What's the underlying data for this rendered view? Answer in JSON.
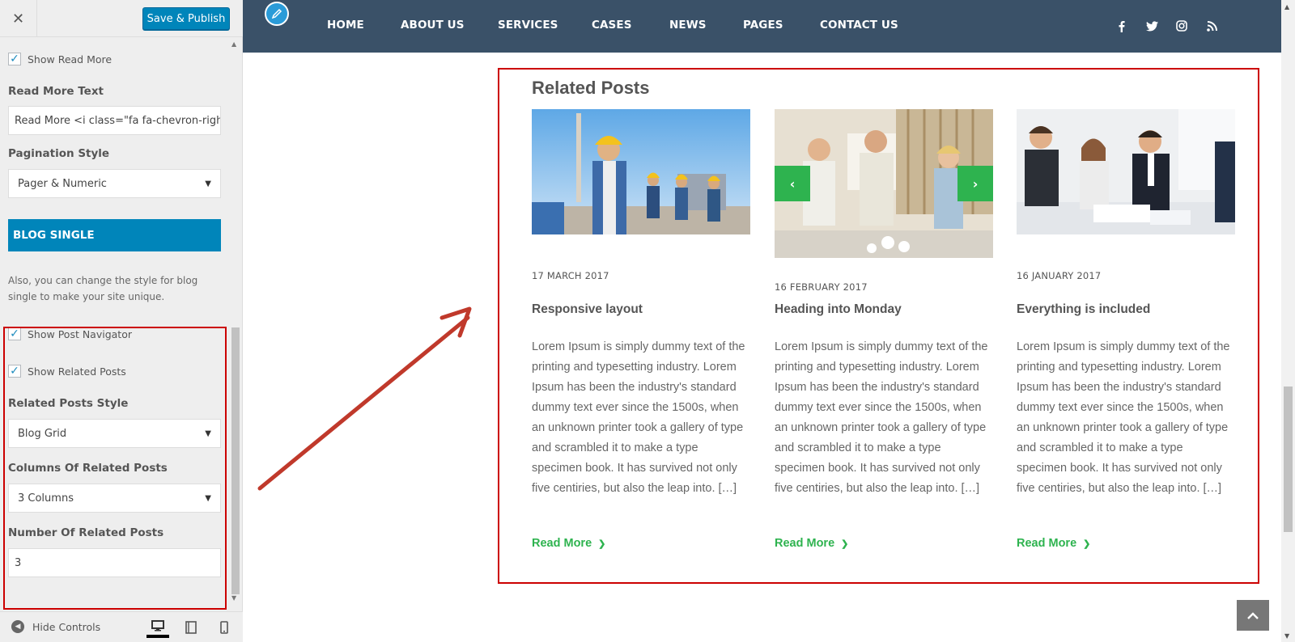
{
  "sidebar": {
    "close_label": "✕",
    "publish_label": "Save & Publish",
    "show_read_more": {
      "label": "Show Read More",
      "checked": true
    },
    "read_more_text": {
      "label": "Read More Text",
      "value": "Read More <i class=\"fa fa-chevron-righ"
    },
    "pagination_style": {
      "label": "Pagination Style",
      "value": "Pager & Numeric"
    },
    "section_heading": "BLOG SINGLE",
    "section_description": "Also, you can change the style for blog single to make your site unique.",
    "show_post_navigator": {
      "label": "Show Post Navigator",
      "checked": true
    },
    "show_related_posts": {
      "label": "Show Related Posts",
      "checked": true
    },
    "related_posts_style": {
      "label": "Related Posts Style",
      "value": "Blog Grid"
    },
    "columns_related": {
      "label": "Columns Of Related Posts",
      "value": "3 Columns"
    },
    "number_related": {
      "label": "Number Of Related Posts",
      "value": "3"
    },
    "footer": {
      "hide_controls": "Hide Controls"
    }
  },
  "nav": {
    "items": [
      "HOME",
      "ABOUT US",
      "SERVICES",
      "CASES",
      "NEWS",
      "PAGES",
      "CONTACT US"
    ],
    "social_icons": [
      "facebook-icon",
      "twitter-icon",
      "instagram-icon",
      "rss-icon"
    ]
  },
  "related": {
    "title": "Related Posts",
    "posts": [
      {
        "date": "17 MARCH 2017",
        "title": "Responsive layout",
        "excerpt": "Lorem Ipsum is simply dummy text of the printing and typesetting industry. Lorem Ipsum has been the industry's standard dummy text ever since the 1500s, when an unknown printer took a gallery of type and scrambled it to make a type specimen book. It has survived not only five centiries, but also the leap into. […]",
        "read_more": "Read More"
      },
      {
        "date": "16 FEBRUARY 2017",
        "title": "Heading into Monday",
        "excerpt": "Lorem Ipsum is simply dummy text of the printing and typesetting industry. Lorem Ipsum has been the industry's standard dummy text ever since the 1500s, when an unknown printer took a gallery of type and scrambled it to make a type specimen book. It has survived not only five centiries, but also the leap into. […]",
        "read_more": "Read More"
      },
      {
        "date": "16 JANUARY 2017",
        "title": "Everything is included",
        "excerpt": "Lorem Ipsum is simply dummy text of the printing and typesetting industry. Lorem Ipsum has been the industry's standard dummy text ever since the 1500s, when an unknown printer took a gallery of type and scrambled it to make a type specimen book. It has survived not only five centiries, but also the leap into. […]",
        "read_more": "Read More"
      }
    ]
  },
  "colors": {
    "nav_bg": "#3a5168",
    "accent_green": "#2eb34f",
    "wp_blue": "#0085ba",
    "highlight_red": "#cc0000"
  }
}
